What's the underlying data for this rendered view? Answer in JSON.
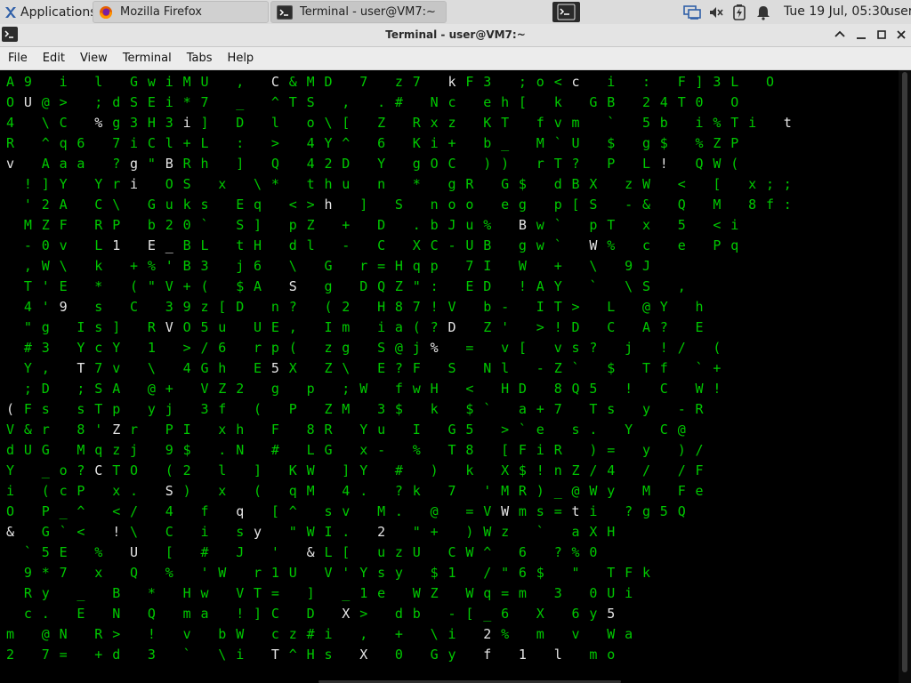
{
  "taskbar": {
    "applications_label": "Applications",
    "tasks": [
      {
        "label": "Mozilla Firefox",
        "icon": "firefox-icon"
      },
      {
        "label": "Terminal - user@VM7:~",
        "icon": "terminal-icon"
      }
    ],
    "clock": "Tue 19 Jul, 05:30",
    "user": "user"
  },
  "window": {
    "title": "Terminal - user@VM7:~"
  },
  "menubar": {
    "items": [
      "File",
      "Edit",
      "View",
      "Terminal",
      "Tabs",
      "Help"
    ]
  },
  "terminal": {
    "foreground": "#00c800",
    "highlight": "#e6e6e6",
    "background": "#000000",
    "columns": [
      {
        "rows": 28,
        "chars": "AO4Rv              &         m2",
        "white": [
          4,
          22
        ]
      },
      {
        "rows": 28,
        "chars": "9U   ",
        "white": [
          1
        ]
      },
      {
        "rows": 28,
        "chars": " @\\^A!'M-,T4\"#Y;(Vd Y ioP` ",
        "white": []
      },
      {
        "rows": 28,
        "chars": "i>Cqa]2Z0W'' 3,D F&U_(P(G \"@7",
        "white": []
      },
      {
        "rows": 28,
        "chars": " ;   YAFv\\E9g                 ",
        "white": []
      }
    ],
    "rows_text": [
      "A9 i l GwiMU   ,  C&MD  7  z7 kF3 ;o<c  i  :  F]3L  O",
      "OU@> ;dSEi*7  _  ^TS  ,  .#  Nc eh[  k  GB 24T0  O",
      "4 \\C %g3H3i] D l  o\\[  Z  Rxz KT fvm  `  5b i%Ti  t",
      "R ^q6 7iCl+L :  >  4Y^  6  Ki+ b_ M`U  $  g$  %ZP",
      "v Aaa ?g\"BRh ] Q  42D  Y  gOC )) rT?  P  L!  QW(",
      "  !]Y Yri OS x \\*  thu  n * gR G$ dBX  zW < [ x;;",
      "  '2A C\\ Guks Eq  <>h  ] S noo eg p[S  -& Q M 8f:",
      "  MZF RP b20` S]  pZ   + D .bJu% Bw`  pT x 5 <i",
      "  -0v L1 E_BL tH  dl   - C XC-UB gw`  W% c e Pq",
      "  ,W\\ k +%'B3  j6   \\ G r=Hqp 7I  W + \\ 9J",
      "  T'E * (\"V+(  $A  S  g DQZ\": ED  !AY ` \\S  ,",
      "  4'9 s C 39z[D  n?   (2 H87!V b-  IT> L @Y  h",
      "  \"g Is] RVO5u  UE,  Im ia(?D Z'  >!D C A?  E",
      "  #3 YcY 1 >/6  rp(  zg S@j% = v[  vs? j !/  (",
      "  Y, T7v \\ 4Gh  E5X  Z\\ E?F S Nl  -Z` $ Tf `+",
      "  ;D ;SA @+ VZ2  g p  ;W fwH < HD  8Q5 ! C W!",
      "(Fs sTp yj 3f  ( P  ZM 3$ k $`  a+7 Ts y -R",
      "V&r 8'Zr PI xh  F  8R Yu I G5  >`e s. Y C@",
      "dUG Mqzj 9$ .N  #  LG x- % T8  [FiR )= y )/",
      "Y _o?CTO (2 l  ]  KW ]Y # ) k  X$!nZ/4 / /F",
      "i (cP x. S) x  (  qM 4. ?k 7 'MR)_@Wy M Fe",
      "O P_^ </ 4 f  q  [^ sv M. @ =VWms=ti ?g5Q",
      "& G`< !\\ C i  sy \"WI. 2 \"+ )Wz ` aXH",
      "  `5E % U [ # J ' &L[ uzU CW^ 6 ?%0",
      "  9*7 x Q % 'W r1U V'Ysy $1 /\"6$ \" TFk",
      "  Ry _ B * Hw VT= ] _1e WZ Wq=m 3 0Ui",
      "  c. E N Q ma !]C D X> db -[_6 X 6y5",
      "m @N R> ! v bW cz#i , + \\i 2% m v Wa",
      "2 7= +d 3 ` \\i T^Hs X 0 Gy f 1 l mo"
    ]
  }
}
